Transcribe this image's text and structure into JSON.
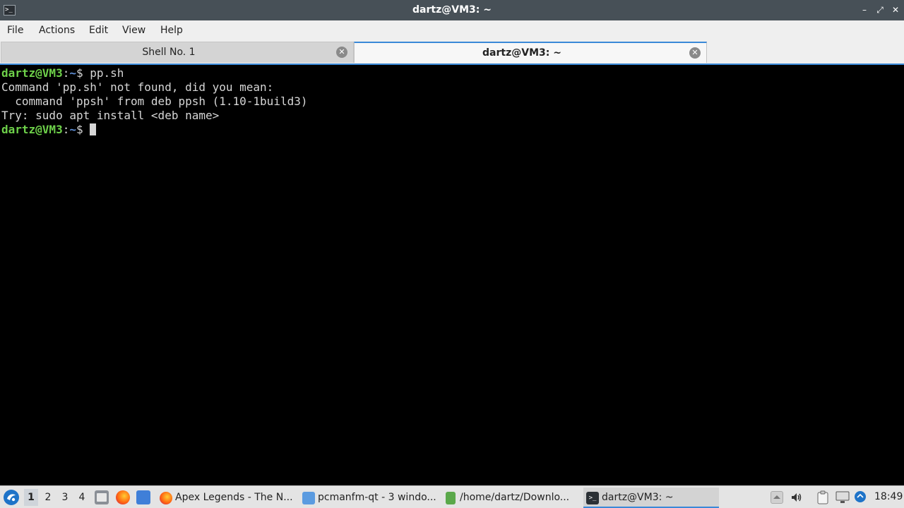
{
  "window": {
    "title": "dartz@VM3: ~",
    "app_icon": "terminal-icon",
    "app_icon_glyph": ">_",
    "minimize_glyph": "–",
    "maximize_glyph": "⤢",
    "close_glyph": "✕"
  },
  "menu": {
    "file": "File",
    "actions": "Actions",
    "edit": "Edit",
    "view": "View",
    "help": "Help"
  },
  "tabs": [
    {
      "label": "Shell No. 1",
      "active": false,
      "close_glyph": "✕"
    },
    {
      "label": "dartz@VM3: ~",
      "active": true,
      "close_glyph": "✕"
    }
  ],
  "terminal": {
    "lines": [
      {
        "user": "dartz@VM3",
        "sep": ":",
        "path": "~",
        "prompt": "$ ",
        "command": "pp.sh"
      },
      {
        "text": "Command 'pp.sh' not found, did you mean:"
      },
      {
        "text": "  command 'ppsh' from deb ppsh (1.10-1build3)"
      },
      {
        "text": "Try: sudo apt install <deb name>"
      },
      {
        "user": "dartz@VM3",
        "sep": ":",
        "path": "~",
        "prompt": "$ ",
        "command": ""
      }
    ],
    "colors": {
      "user": "#6ed14a",
      "path": "#5f8fd6",
      "text": "#d6d6d6",
      "background": "#000000"
    }
  },
  "taskbar": {
    "start_icon": "lubuntu-start-icon",
    "desktops": [
      "1",
      "2",
      "3",
      "4"
    ],
    "active_desktop": "1",
    "launchers": [
      "file-manager-icon",
      "firefox-icon",
      "show-desktop-icon"
    ],
    "tasks": [
      {
        "label": "Apex Legends - The N...",
        "icon": "firefox-icon"
      },
      {
        "label": "pcmanfm-qt - 3 windo...",
        "icon": "folder-icon"
      },
      {
        "label": "/home/dartz/Downlo...",
        "icon": "archive-icon"
      },
      {
        "label": "dartz@VM3: ~",
        "icon": "terminal-icon",
        "active": true
      }
    ],
    "tray": [
      "tray-up-arrow-icon",
      "volume-icon",
      "clipboard-icon",
      "display-icon",
      "network-icon"
    ],
    "clock": "18:49"
  },
  "colors": {
    "accent": "#3a89d8",
    "titlebar": "#475057",
    "menubar": "#efefef",
    "taskbar": "#e4e4e4"
  }
}
